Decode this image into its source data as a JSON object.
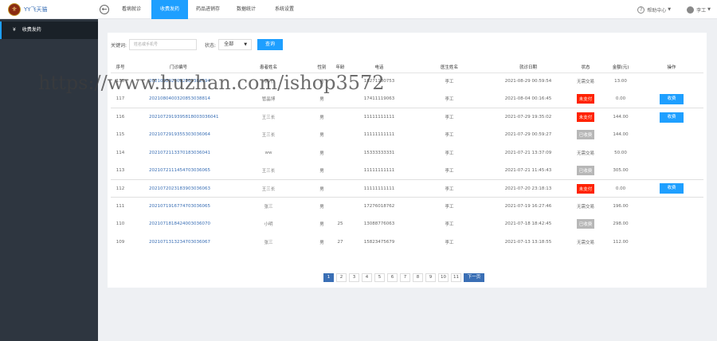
{
  "app": {
    "title": "YY飞天猫"
  },
  "topnav": {
    "tabs": [
      "看病就诊",
      "收费发药",
      "药品进销存",
      "数据统计",
      "系统设置"
    ],
    "active_index": 1
  },
  "topright": {
    "help": "帮助中心",
    "user": "李工"
  },
  "sidebar": {
    "items": [
      {
        "icon": "¥",
        "label": "收费发药"
      }
    ]
  },
  "search": {
    "keyword_label": "关键词:",
    "keyword_placeholder": "姓名或手机号",
    "status_label": "状态:",
    "status_value": "全部",
    "submit_label": "查询"
  },
  "table": {
    "columns": [
      "序号",
      "门诊编号",
      "患者姓名",
      "性别",
      "年龄",
      "电话",
      "医生姓名",
      "就诊日期",
      "状态",
      "金额(元)",
      "操作"
    ],
    "rows": [
      {
        "no": "118",
        "code": "2021082923082501382594",
        "name": "啊飞",
        "gender": "男",
        "age": "",
        "phone": "18271180753",
        "doctor": "李工",
        "date": "2021-08-29 00:59:54",
        "status": "无需交易",
        "status_style": "plain",
        "amount": "13.00",
        "action": ""
      },
      {
        "no": "117",
        "code": "2021080400320853038814",
        "name": "管晶博",
        "gender": "男",
        "age": "",
        "phone": "17411119063",
        "doctor": "李工",
        "date": "2021-08-04 00:16:45",
        "status": "未支付",
        "status_style": "red",
        "amount": "0.00",
        "action": "收费"
      },
      {
        "no": "116",
        "code": "2021072919395818003036041",
        "name": "王三长",
        "gender": "男",
        "age": "",
        "phone": "11111111111",
        "doctor": "李工",
        "date": "2021-07-29 19:35:02",
        "status": "未支付",
        "status_style": "red",
        "amount": "144.00",
        "action": "收费"
      },
      {
        "no": "115",
        "code": "2021072919355303036064",
        "name": "王三长",
        "gender": "男",
        "age": "",
        "phone": "11111111111",
        "doctor": "李工",
        "date": "2021-07-29 00:59:27",
        "status": "已收费",
        "status_style": "gray",
        "amount": "144.00",
        "action": ""
      },
      {
        "no": "114",
        "code": "2021072113370183036041",
        "name": "ww",
        "gender": "男",
        "age": "",
        "phone": "15333333331",
        "doctor": "李工",
        "date": "2021-07-21 13:37:09",
        "status": "无需交易",
        "status_style": "plain",
        "amount": "50.00",
        "action": ""
      },
      {
        "no": "113",
        "code": "2021072111454703036065",
        "name": "王三长",
        "gender": "男",
        "age": "",
        "phone": "11111111111",
        "doctor": "李工",
        "date": "2021-07-21 11:45:43",
        "status": "已收费",
        "status_style": "gray",
        "amount": "305.00",
        "action": ""
      },
      {
        "no": "112",
        "code": "2021072023183903036063",
        "name": "王三长",
        "gender": "男",
        "age": "",
        "phone": "11111111111",
        "doctor": "李工",
        "date": "2021-07-20 23:18:13",
        "status": "未支付",
        "status_style": "red",
        "amount": "0.00",
        "action": "收费"
      },
      {
        "no": "111",
        "code": "2021071916774703036065",
        "name": "张三",
        "gender": "男",
        "age": "",
        "phone": "17276018762",
        "doctor": "李工",
        "date": "2021-07-19 16:27:46",
        "status": "无需交易",
        "status_style": "plain",
        "amount": "196.00",
        "action": ""
      },
      {
        "no": "110",
        "code": "2021071818424003036070",
        "name": "小明",
        "gender": "男",
        "age": "25",
        "phone": "13088776063",
        "doctor": "李工",
        "date": "2021-07-18 18:42:45",
        "status": "已收费",
        "status_style": "gray",
        "amount": "298.00",
        "action": ""
      },
      {
        "no": "109",
        "code": "2021071313234703036067",
        "name": "张三",
        "gender": "男",
        "age": "27",
        "phone": "15823475679",
        "doctor": "李工",
        "date": "2021-07-13 13:18:55",
        "status": "无需交易",
        "status_style": "plain",
        "amount": "112.00",
        "action": ""
      }
    ]
  },
  "pagination": {
    "pages": [
      "1",
      "2",
      "3",
      "4",
      "5",
      "6",
      "7",
      "8",
      "9",
      "10",
      "11"
    ],
    "current": "1",
    "next_label": "下一页"
  },
  "watermark": "https://www.huzhan.com/ishop3572",
  "colors": {
    "accent": "#1e9fff",
    "sidebar": "#2e3640",
    "danger": "#ff2200",
    "link": "#3a6fb5"
  }
}
